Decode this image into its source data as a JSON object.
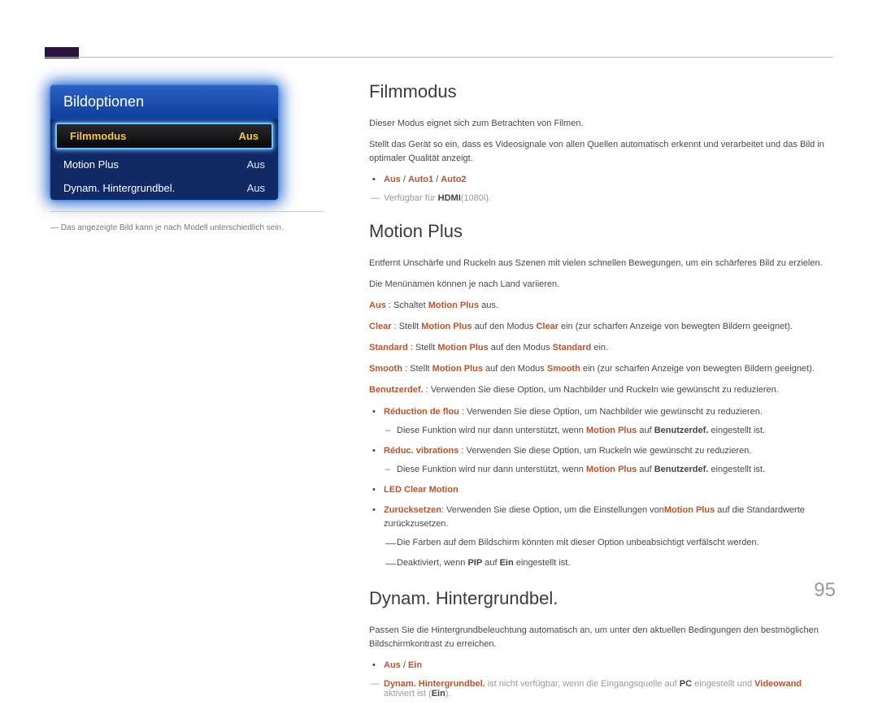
{
  "page_number": "95",
  "panel": {
    "title": "Bildoptionen",
    "rows": [
      {
        "label": "Filmmodus",
        "value": "Aus",
        "selected": true
      },
      {
        "label": "Motion Plus",
        "value": "Aus",
        "selected": false
      },
      {
        "label": "Dynam. Hintergrundbel.",
        "value": "Aus",
        "selected": false
      }
    ]
  },
  "side_note": "Das angezeigte Bild kann je nach Modell unterschiedlich sein.",
  "sections": {
    "filmmodus": {
      "title": "Filmmodus",
      "p1": "Dieser Modus eignet sich zum Betrachten von Filmen.",
      "p2": "Stellt das Gerät so ein, dass es Videosignale von allen Quellen automatisch erkennt und verarbeitet und das Bild in optimaler Qualität anzeigt.",
      "bullet": {
        "aus": "Aus",
        "auto1": "Auto1",
        "auto2": "Auto2"
      },
      "note_prefix": "Verfügbar für ",
      "note_hdmi": "HDMI",
      "note_suffix": "(1080i)."
    },
    "motionplus": {
      "title": "Motion Plus",
      "p1": "Entfernt Unschärfe und Ruckeln aus Szenen mit vielen schnellen Bewegungen, um ein schärferes Bild zu erzielen.",
      "p2": "Die Menünamen können je nach Land variieren.",
      "aus": {
        "label": "Aus",
        "text": " : Schaltet ",
        "mp": "Motion Plus",
        "text2": " aus."
      },
      "clear": {
        "label": "Clear",
        "text": " : Stellt ",
        "mp": "Motion Plus",
        "text2": " auf den Modus ",
        "mode": "Clear",
        "text3": " ein (zur scharfen Anzeige von bewegten Bildern geeignet)."
      },
      "standard": {
        "label": "Standard",
        "text": " : Stellt ",
        "mp": "Motion Plus",
        "text2": " auf den Modus ",
        "mode": "Standard",
        "text3": " ein."
      },
      "smooth": {
        "label": "Smooth",
        "text": " : Stellt ",
        "mp": "Motion Plus",
        "text2": " auf den Modus ",
        "mode": "Smooth",
        "text3": " ein (zur scharfen Anzeige von bewegten Bildern geeignet)."
      },
      "benutzer": {
        "label": "Benutzerdef.",
        "text": " : Verwenden Sie diese Option, um Nachbilder und Ruckeln wie gewünscht zu reduzieren."
      },
      "bullets": {
        "reduc_flou": {
          "label": "Réduction de flou",
          "text": " : Verwenden Sie diese Option, um Nachbilder wie gewünscht zu reduzieren."
        },
        "reduc_flou_sub": {
          "pre": "Diese Funktion wird nur dann unterstützt, wenn ",
          "mp": "Motion Plus",
          "mid": " auf ",
          "bd": "Benutzerdef.",
          "post": " eingestellt ist."
        },
        "reduc_vib": {
          "label": "Réduc. vibrations",
          "text": " : Verwenden Sie diese Option, um Ruckeln wie gewünscht zu reduzieren."
        },
        "reduc_vib_sub": {
          "pre": "Diese Funktion wird nur dann unterstützt, wenn ",
          "mp": "Motion Plus",
          "mid": " auf ",
          "bd": "Benutzerdef.",
          "post": " eingestellt ist."
        },
        "led": "LED Clear Motion",
        "reset": {
          "label": "Zurücksetzen",
          "text": ": Verwenden Sie diese Option, um die Einstellungen von",
          "mp": "Motion Plus",
          "text2": " auf die Standardwerte zurückzusetzen."
        },
        "reset_sub1": "Die Farben auf dem Bildschirm könnten mit dieser Option unbeabsichtigt verfälscht werden.",
        "reset_sub2": {
          "pre": "Deaktiviert, wenn ",
          "pip": "PIP",
          "mid": " auf ",
          "ein": "Ein",
          "post": " eingestellt ist."
        }
      }
    },
    "dynam": {
      "title": "Dynam. Hintergrundbel.",
      "p1": "Passen Sie die Hintergrundbeleuchtung automatisch an, um unter den aktuellen Bedingungen den bestmöglichen Bildschirmkontrast zu erreichen.",
      "bullet": {
        "aus": "Aus",
        "ein": "Ein"
      },
      "note": {
        "hb": "Dynam. Hintergrundbel.",
        "t1": " ist nicht verfügbar, wenn die Eingangsquelle auf ",
        "pc": "PC",
        "t2": " eingestellt und ",
        "vw": "Videowand",
        "t3": " aktiviert ist (",
        "ein": "Ein",
        "t4": ")."
      }
    }
  }
}
